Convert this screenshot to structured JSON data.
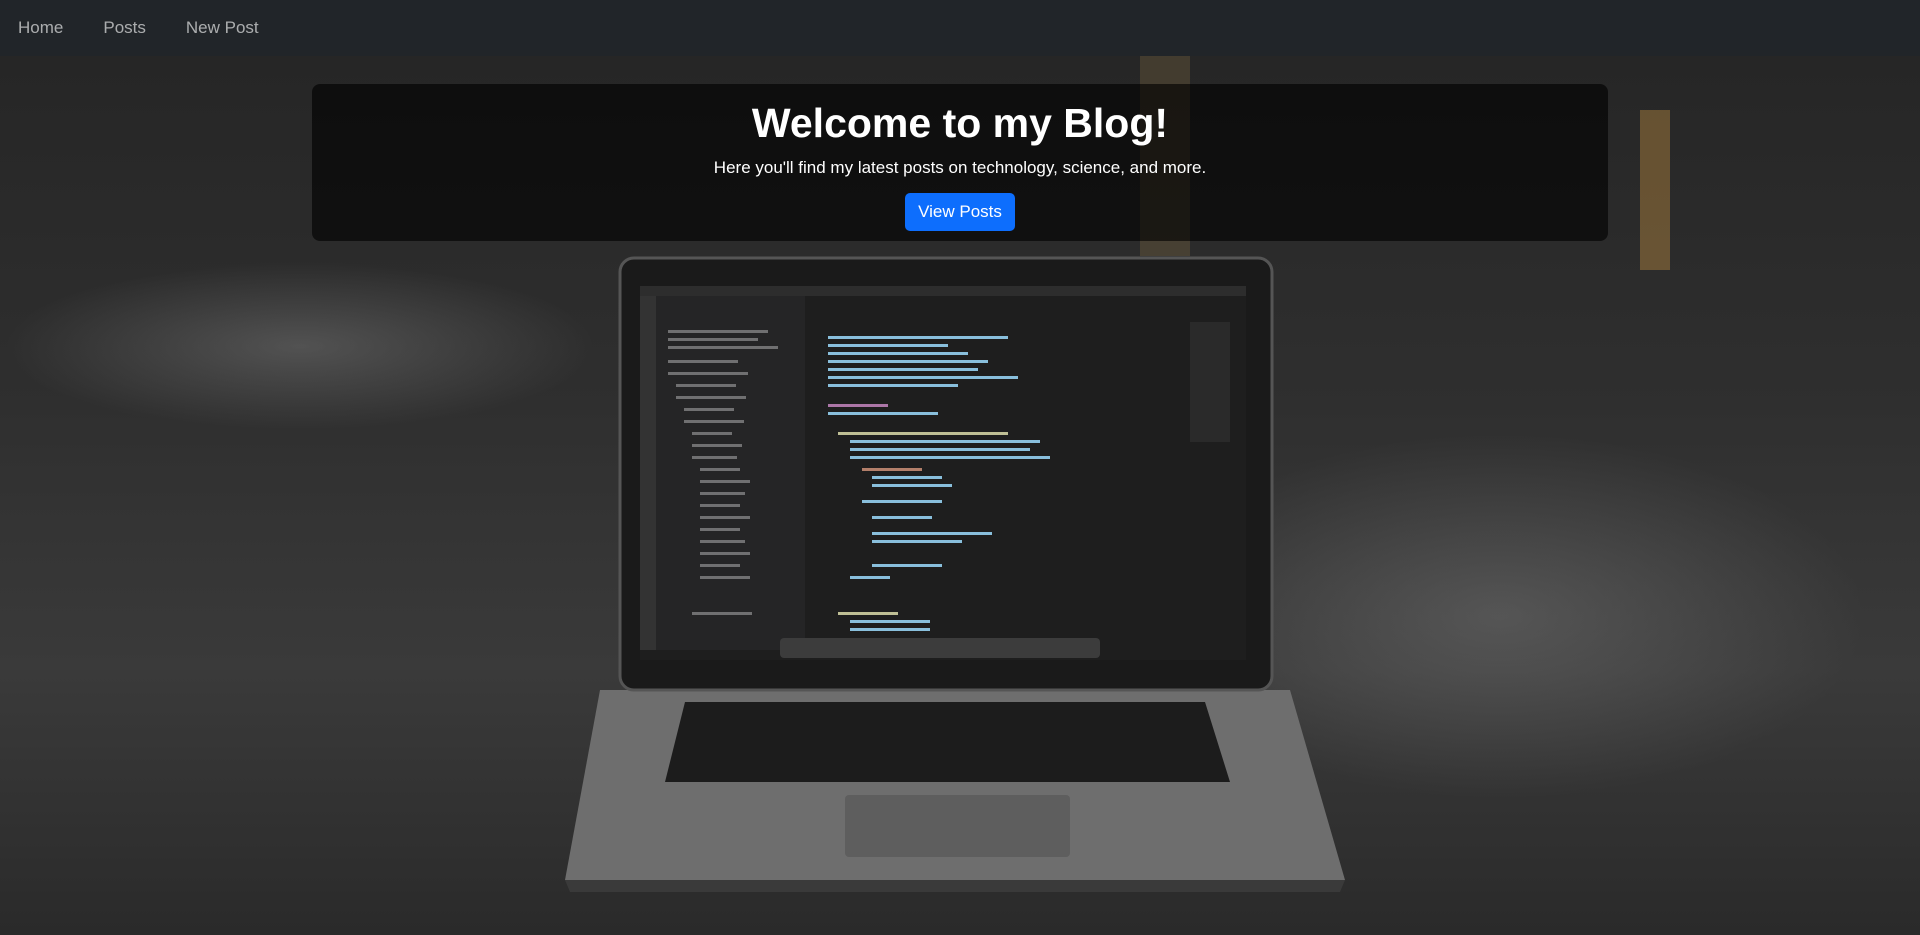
{
  "nav": {
    "items": [
      {
        "label": "Home"
      },
      {
        "label": "Posts"
      },
      {
        "label": "New Post"
      }
    ]
  },
  "hero": {
    "title": "Welcome to my Blog!",
    "subtitle": "Here you'll find my latest posts on technology, science, and more.",
    "button_label": "View Posts"
  },
  "colors": {
    "navbar_bg": "#212529",
    "button_bg": "#0d6efd"
  },
  "background": {
    "image": "laptop-on-concrete-photo"
  }
}
